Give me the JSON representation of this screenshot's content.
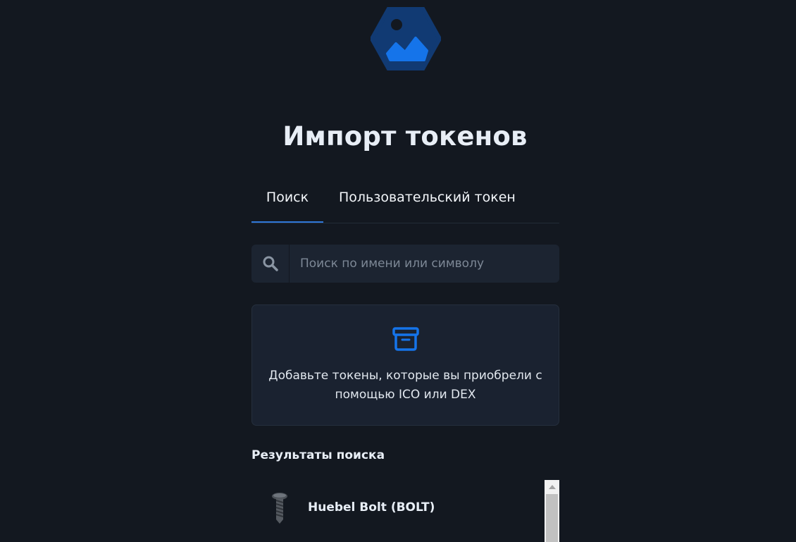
{
  "logo": {
    "icon": "image-placeholder-icon",
    "colors": {
      "hex_bg": "#113a73",
      "fg": "#1574ea"
    }
  },
  "page_title": "Импорт токенов",
  "tabs": [
    {
      "label": "Поиск",
      "active": true
    },
    {
      "label": "Пользовательский токен",
      "active": false
    }
  ],
  "search": {
    "icon": "search-icon",
    "placeholder": "Поиск по имени или символу",
    "value": ""
  },
  "info_card": {
    "icon": "archive-box-icon",
    "text": "Добавьте токены, которые вы приобрели с помощью ICO или DEX"
  },
  "results": {
    "heading": "Результаты поиска",
    "items": [
      {
        "name": "Huebel Bolt (BOLT)",
        "icon": "bolt-screw-icon"
      }
    ]
  },
  "colors": {
    "background": "#131820",
    "surface": "#1c2431",
    "accent": "#2f77d8",
    "text": "#e6edf5",
    "muted": "#7d8896"
  }
}
